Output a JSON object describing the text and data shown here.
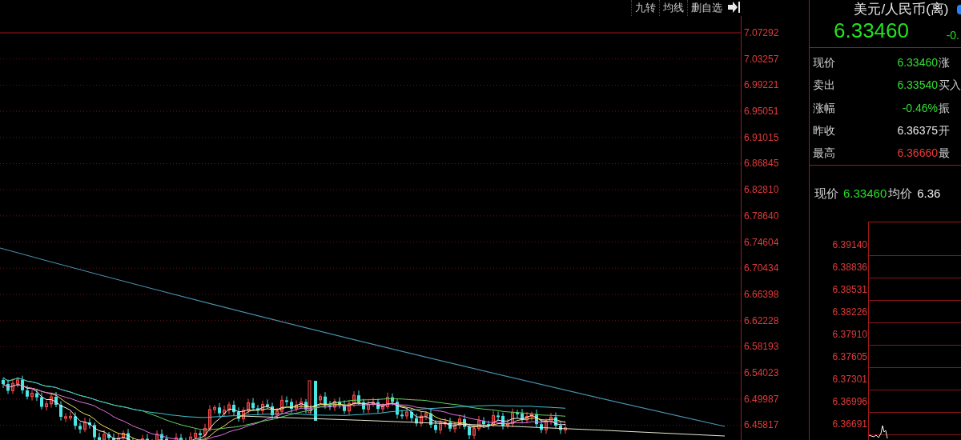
{
  "toolbar": {
    "buttons": [
      "九转",
      "均线",
      "删自选"
    ]
  },
  "main_chart": {
    "y_axis_labels": [
      "7.07292",
      "7.03257",
      "6.99221",
      "6.95051",
      "6.91015",
      "6.86845",
      "6.82810",
      "6.78640",
      "6.74604",
      "6.70434",
      "6.66398",
      "6.62228",
      "6.58193",
      "6.54023",
      "6.49987",
      "6.45817"
    ]
  },
  "quote": {
    "title": "美元/人民币(离)",
    "price": "6.33460",
    "change": "-0.",
    "rows": [
      {
        "label": "现价",
        "value": "6.33460",
        "color": "#33dd33",
        "label_2": "涨"
      },
      {
        "label": "卖出",
        "value": "6.33540",
        "color": "#33dd33",
        "label_2": "买入"
      },
      {
        "label": "涨幅",
        "value": "-0.46%",
        "color": "#33dd33",
        "label_2": "振"
      },
      {
        "label": "昨收",
        "value": "6.36375",
        "color": "#e8e8e8",
        "label_2": "开"
      },
      {
        "label": "最高",
        "value": "6.36660",
        "color": "#e83a3a",
        "label_2": "最"
      }
    ]
  },
  "intraday": {
    "price_label": "现价",
    "price": "6.33460",
    "avg_label": "均价",
    "avg": "6.36",
    "y_axis_labels": [
      "6.39140",
      "6.38836",
      "6.38531",
      "6.38226",
      "6.37910",
      "6.37605",
      "6.37301",
      "6.36996",
      "6.36691"
    ]
  }
}
